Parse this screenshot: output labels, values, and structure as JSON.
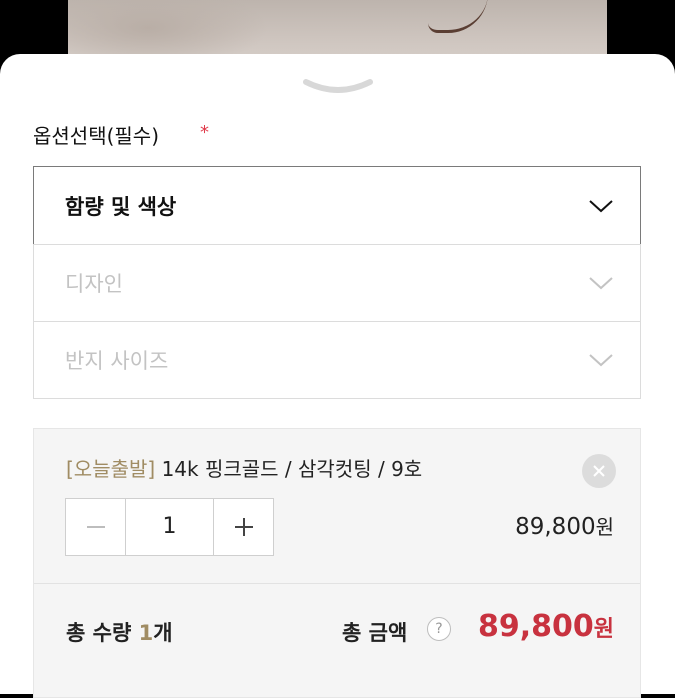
{
  "options": {
    "label": "옵션선택(필수)",
    "required_mark": "*",
    "selects": [
      {
        "label": "함량 및 색상",
        "state": "active"
      },
      {
        "label": "디자인",
        "state": "disabled"
      },
      {
        "label": "반지 사이즈",
        "state": "disabled"
      }
    ]
  },
  "selected_item": {
    "badge": "[오늘출발]",
    "name": "14k 핑크골드 / 삼각컷팅 / 9호",
    "quantity": "1",
    "price": "89,800",
    "price_unit": "원"
  },
  "totals": {
    "quantity_label": "총 수량",
    "quantity_value": "1",
    "quantity_unit": "개",
    "amount_label": "총 금액",
    "help_icon": "?",
    "amount_value": "89,800",
    "amount_unit": "원"
  },
  "colors": {
    "accent_red": "#c8323f",
    "badge_gold": "#a08c63",
    "required_red": "#e03a4a"
  }
}
